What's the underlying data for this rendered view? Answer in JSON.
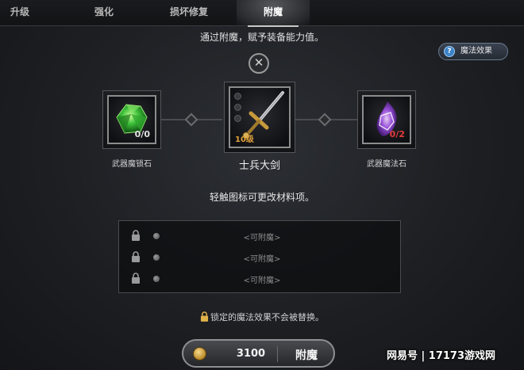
{
  "tabs": [
    {
      "label": "升级",
      "active": false
    },
    {
      "label": "强化",
      "active": false
    },
    {
      "label": "损坏修复",
      "active": false
    },
    {
      "label": "附魔",
      "active": true
    }
  ],
  "top_hint": "通过附魔，赋予装备能力值。",
  "magic_effect_button": {
    "label": "魔法效果",
    "icon": "question-icon"
  },
  "close_icon": "close-icon",
  "left_item": {
    "name": "武器魔锁石",
    "count": "0/0",
    "icon": "green-gem-icon",
    "accent": "#3ec23b"
  },
  "center_item": {
    "name": "士兵大剑",
    "level": "10级",
    "icon": "sword-icon"
  },
  "right_item": {
    "name": "武器魔法石",
    "count": "0/2",
    "icon": "purple-crystal-icon",
    "accent": "#9b4fe0"
  },
  "middle_hint": "轻触图标可更改材料项。",
  "enchant_options": [
    {
      "text": "<可附魔>",
      "locked": false
    },
    {
      "text": "<可附魔>",
      "locked": false
    },
    {
      "text": "<可附魔>",
      "locked": false
    }
  ],
  "lock_note": "锁定的魔法效果不会被替换。",
  "enchant_button": {
    "cost": "3100",
    "label": "附魔",
    "currency_icon": "gold-coin-icon"
  },
  "watermark": "网易号 | 17173游戏网"
}
